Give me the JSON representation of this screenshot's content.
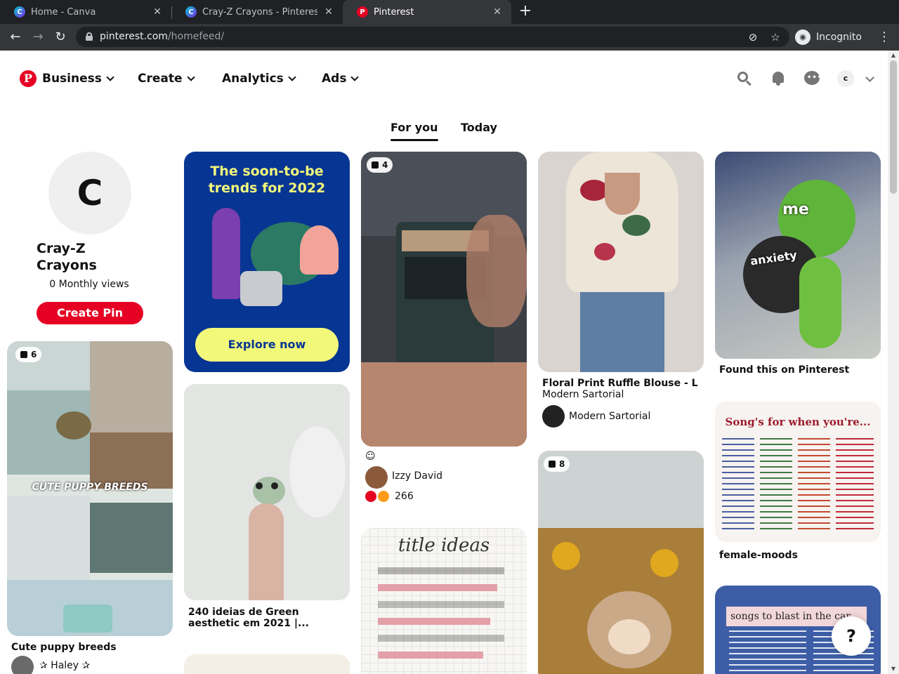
{
  "browser": {
    "tabs": [
      {
        "title": "Home - Canva",
        "favicon": "canva-icon"
      },
      {
        "title": "Cray-Z Crayons - Pinterest",
        "favicon": "canva-icon"
      },
      {
        "title": "Pinterest",
        "favicon": "pinterest-icon",
        "active": true
      }
    ],
    "url_host": "pinterest.com",
    "url_path": "/homefeed/",
    "profile_label": "Incognito"
  },
  "header": {
    "nav": [
      "Business",
      "Create",
      "Analytics",
      "Ads"
    ],
    "account_initial": "c"
  },
  "feed_tabs": [
    "For you",
    "Today"
  ],
  "profile": {
    "initial": "C",
    "name": "Cray-Z Crayons",
    "monthly_views": "0 Monthly views",
    "create_pin": "Create Pin"
  },
  "promo": {
    "title": "The soon-to-be trends for 2022",
    "cta": "Explore now"
  },
  "pins": {
    "puppy": {
      "badge": "6",
      "overlay": "CUTE PUPPY BREEDS",
      "title": "Cute puppy breeds",
      "author": "✰ Haley ✰"
    },
    "frog": {
      "title": "240 ideias de Green aesthetic em 2021 |..."
    },
    "train": {
      "badge": "4",
      "caption": "☺",
      "author": "Izzy David",
      "reactions": "266"
    },
    "notebook": {
      "heading": "title ideas"
    },
    "blouse": {
      "title": "Floral Print Ruffle Blouse - L",
      "subtitle": "Modern Sartorial",
      "author": "Modern Sartorial"
    },
    "hedgehog": {
      "badge": "8"
    },
    "kermit": {
      "text_top": "me",
      "text_bottom": "anxiety",
      "title": "Found this on Pinterest"
    },
    "songs": {
      "heading": "Song's for when you're...",
      "title": "female-moods"
    },
    "blast": {
      "heading": "songs to blast in the car"
    }
  },
  "help": "?",
  "colors": {
    "brand": "#e60023",
    "promo_bg": "#073593",
    "promo_accent": "#f2f87a"
  }
}
